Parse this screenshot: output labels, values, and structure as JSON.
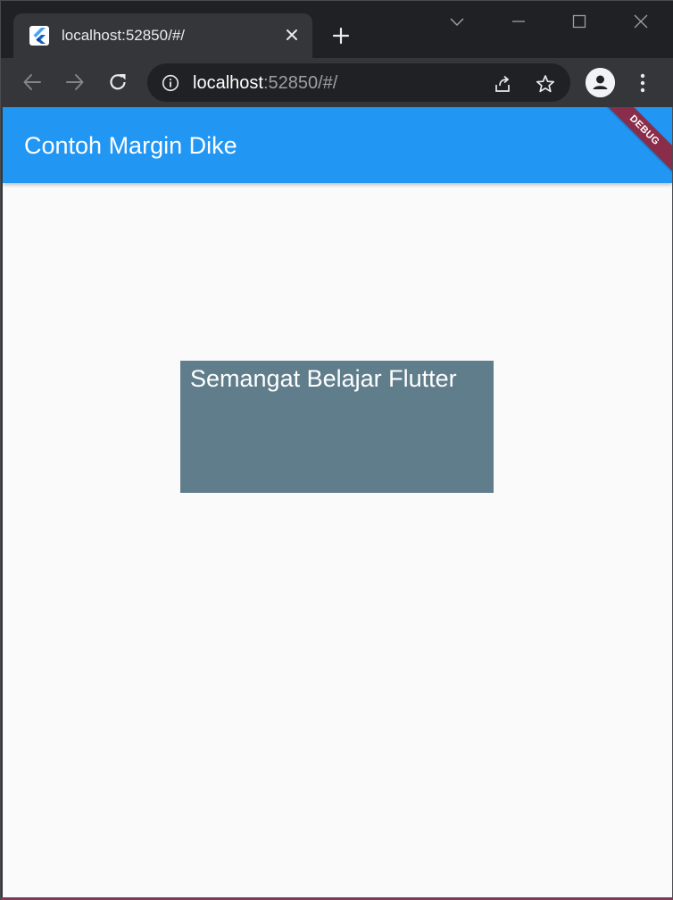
{
  "browser": {
    "tab": {
      "title": "localhost:52850/#/",
      "favicon": "flutter-logo-icon"
    },
    "new_tab_icon": "plus-icon",
    "window_controls": [
      "chevron-down-icon",
      "minimize-icon",
      "maximize-icon",
      "close-icon"
    ],
    "nav": {
      "back_icon": "arrow-left-icon",
      "forward_icon": "arrow-right-icon",
      "reload_icon": "reload-icon"
    },
    "omnibox": {
      "info_icon": "info-icon",
      "host": "localhost",
      "rest": ":52850/#/",
      "share_icon": "share-icon",
      "bookmark_icon": "star-icon"
    },
    "profile_icon": "person-icon",
    "menu_icon": "vertical-dots-icon"
  },
  "app": {
    "appbar_title": "Contoh Margin Dike",
    "debug_banner": "DEBUG",
    "container_text": "Semangat Belajar Flutter"
  },
  "colors": {
    "appbar": "#2196f3",
    "container": "#607d8b",
    "debug_banner": "#8a2d4a",
    "background": "#fafafa"
  }
}
